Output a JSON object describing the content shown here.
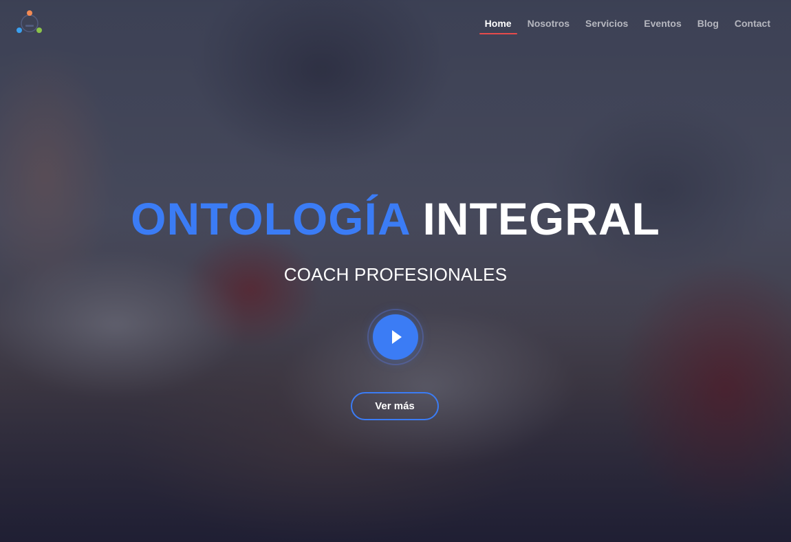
{
  "nav": {
    "items": [
      {
        "label": "Home",
        "active": true
      },
      {
        "label": "Nosotros",
        "active": false
      },
      {
        "label": "Servicios",
        "active": false
      },
      {
        "label": "Eventos",
        "active": false
      },
      {
        "label": "Blog",
        "active": false
      },
      {
        "label": "Contact",
        "active": false
      }
    ],
    "active_underline_color": "#e84b4b"
  },
  "logo": {
    "icon": "people-circle-logo",
    "dot_colors": [
      "#f28a54",
      "#3aa0f0",
      "#8bc34a"
    ]
  },
  "hero": {
    "title_accent": "ONTOLOGÍA",
    "title_main": "INTEGRAL",
    "subtitle": "COACH PROFESIONALES",
    "play_icon": "play-icon",
    "cta_label": "Ver más",
    "accent_color": "#3b7cf5"
  }
}
